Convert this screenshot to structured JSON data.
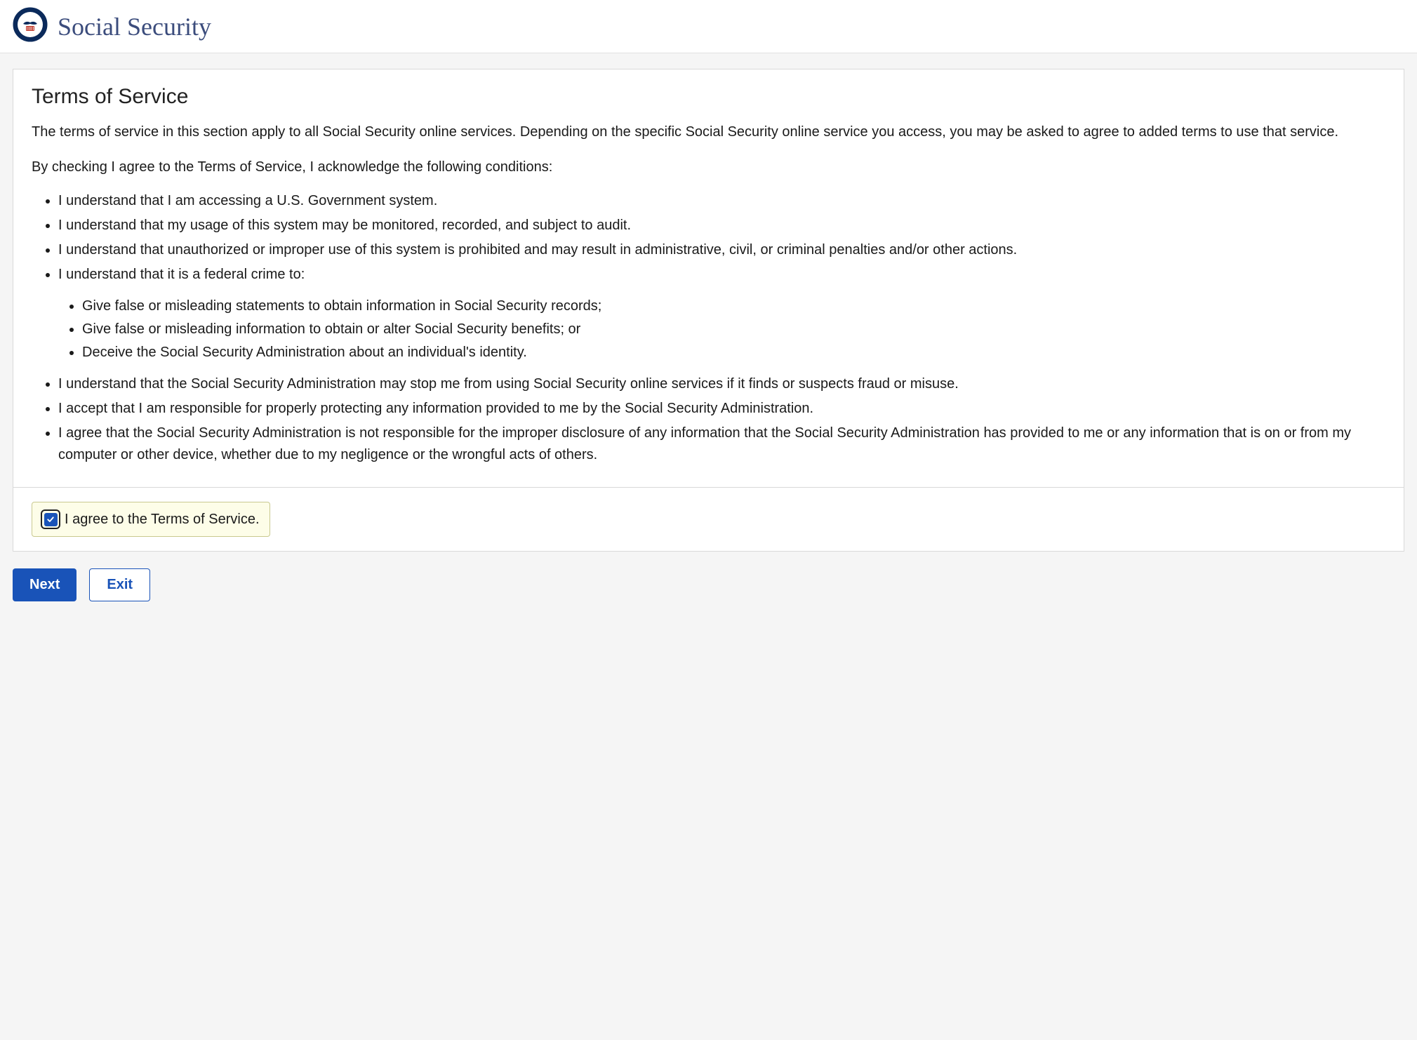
{
  "header": {
    "brand": "Social Security"
  },
  "card": {
    "title": "Terms of Service",
    "intro": "The terms of service in this section apply to all Social Security online services. Depending on the specific Social Security online service you access, you may be asked to agree to added terms to use that service.",
    "conditions_intro": "By checking I agree to the Terms of Service, I acknowledge the following conditions:",
    "conditions": [
      "I understand that I am accessing a U.S. Government system.",
      "I understand that my usage of this system may be monitored, recorded, and subject to audit.",
      "I understand that unauthorized or improper use of this system is prohibited and may result in administrative, civil, or criminal penalties and/or other actions.",
      "I understand that it is a federal crime to:"
    ],
    "crime_sub": [
      "Give false or misleading statements to obtain information in Social Security records;",
      "Give false or misleading information to obtain or alter Social Security benefits; or",
      "Deceive the Social Security Administration about an individual's identity."
    ],
    "conditions_after": [
      "I understand that the Social Security Administration may stop me from using Social Security online services if it finds or suspects fraud or misuse.",
      "I accept that I am responsible for properly protecting any information provided to me by the Social Security Administration.",
      "I agree that the Social Security Administration is not responsible for the improper disclosure of any information that the Social Security Administration has provided to me or any information that is on or from my computer or other device, whether due to my negligence or the wrongful acts of others."
    ],
    "agree_label": "I agree to the Terms of Service.",
    "agree_checked": true
  },
  "buttons": {
    "next": "Next",
    "exit": "Exit"
  }
}
